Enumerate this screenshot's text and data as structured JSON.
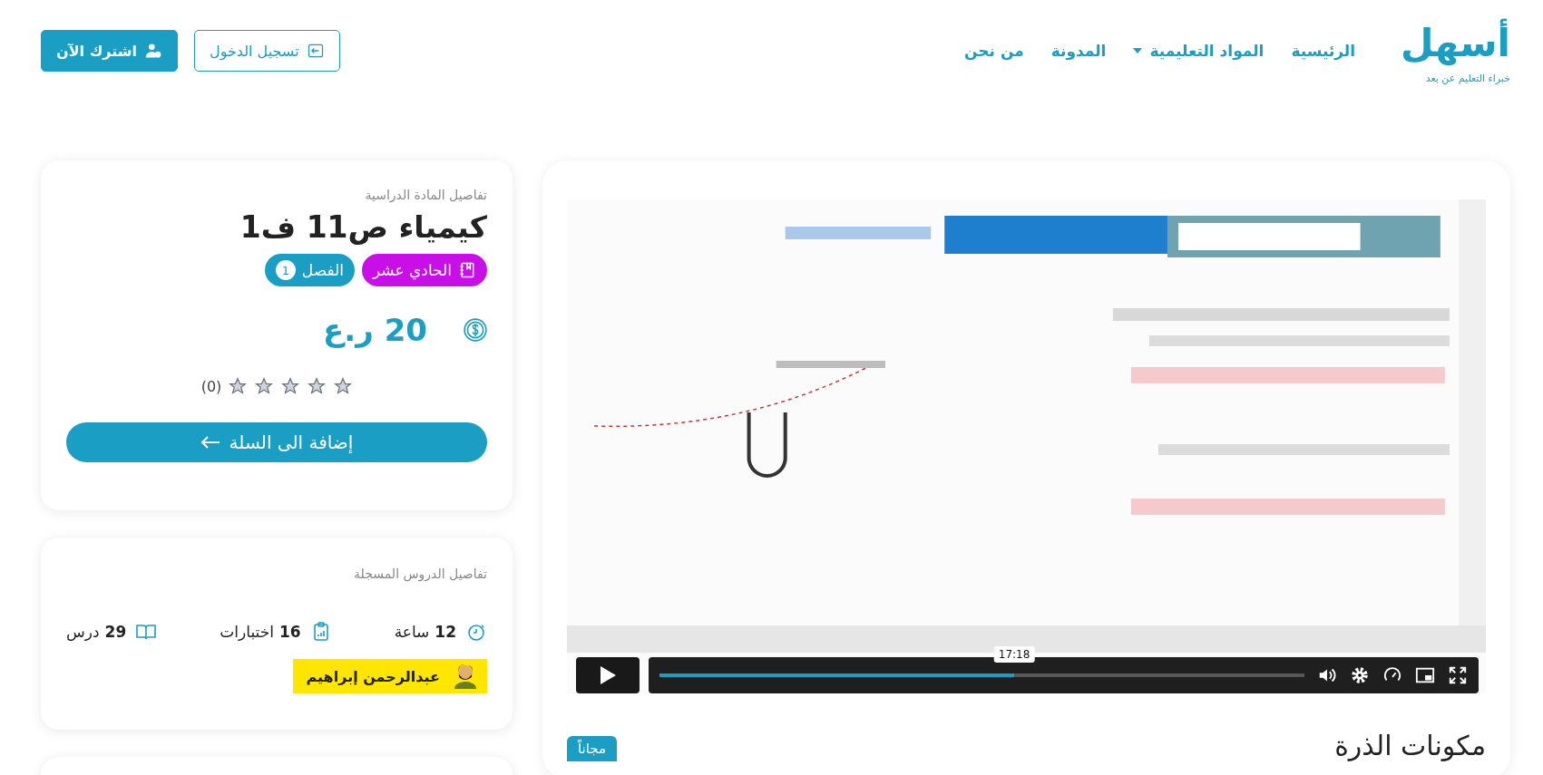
{
  "header": {
    "logo": {
      "name": "أسهل",
      "tagline": "خبراء التعليم عن بعد"
    },
    "nav": [
      {
        "label": "الرئيسية",
        "dropdown": false
      },
      {
        "label": "المواد التعليمية",
        "dropdown": true
      },
      {
        "label": "المدونة",
        "dropdown": false
      },
      {
        "label": "من نحن",
        "dropdown": false
      }
    ],
    "buttons": [
      {
        "label": "تسجيل الدخول",
        "kind": "outline"
      },
      {
        "label": "اشترك الآن",
        "kind": "filled"
      }
    ]
  },
  "video": {
    "kind": "picture",
    "time": "17:18",
    "progress": {
      "level": 0.55
    },
    "title": "مكونات الذرة",
    "badge": "مجاناً"
  },
  "course": {
    "subtitle": "تفاصيل المادة الدراسية",
    "title": "كيمياء ص11 ف1",
    "tags": [
      {
        "kind": "grade",
        "label": "الحادي عشر",
        "color": "#c90fe8"
      },
      {
        "kind": "term",
        "label": "الفصل",
        "number": "1",
        "color": "#1a9ec4"
      }
    ],
    "price": "20 ر.ع",
    "rating": {
      "stars": 0,
      "count": "(0)"
    },
    "cart_button": "إضافة الى السلة"
  },
  "lessons": {
    "subtitle": "تفاصيل الدروس المسجلة",
    "stats": [
      {
        "kind": "hours",
        "number": "12",
        "label": "ساعة"
      },
      {
        "kind": "tests",
        "number": "16",
        "label": "اختبارات"
      },
      {
        "kind": "lessons",
        "number": "29",
        "label": "درس"
      }
    ],
    "teacher": "عبدالرحمن إبراهيم"
  }
}
